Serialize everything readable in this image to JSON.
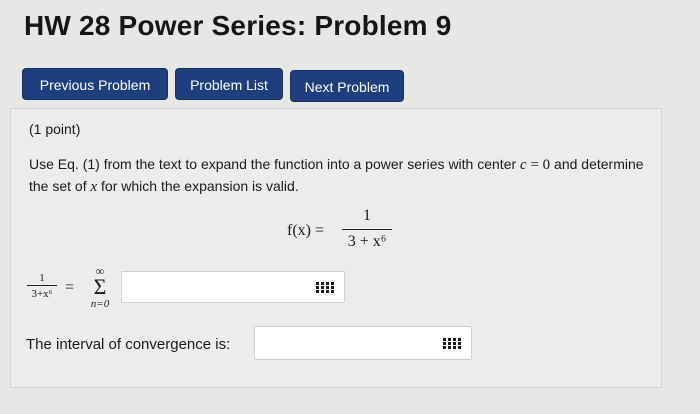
{
  "page_title": "HW 28 Power Series: Problem 9",
  "nav": {
    "previous": "Previous Problem",
    "list": "Problem List",
    "next": "Next Problem",
    "button_color": "#1f3e7d"
  },
  "problem": {
    "points": "(1 point)",
    "text_part1": "Use Eq. (1) from the text to expand the function into a power series with center ",
    "center_var": "c",
    "center_eq": " = 0",
    "text_part2": " and determine the set of ",
    "var_x": "x",
    "text_part3": " for which the expansion is valid."
  },
  "formula": {
    "lhs": "f(x) =",
    "numerator": "1",
    "denominator": "3 + x⁶"
  },
  "series": {
    "frac_num": "1",
    "frac_den": "3+x⁶",
    "equals": "=",
    "upper": "∞",
    "sigma": "Σ",
    "lower": "n=0",
    "answer_value": ""
  },
  "interval": {
    "label": "The interval of convergence is:",
    "answer_value": ""
  },
  "icons": {
    "keypad": "equation-editor-icon"
  }
}
